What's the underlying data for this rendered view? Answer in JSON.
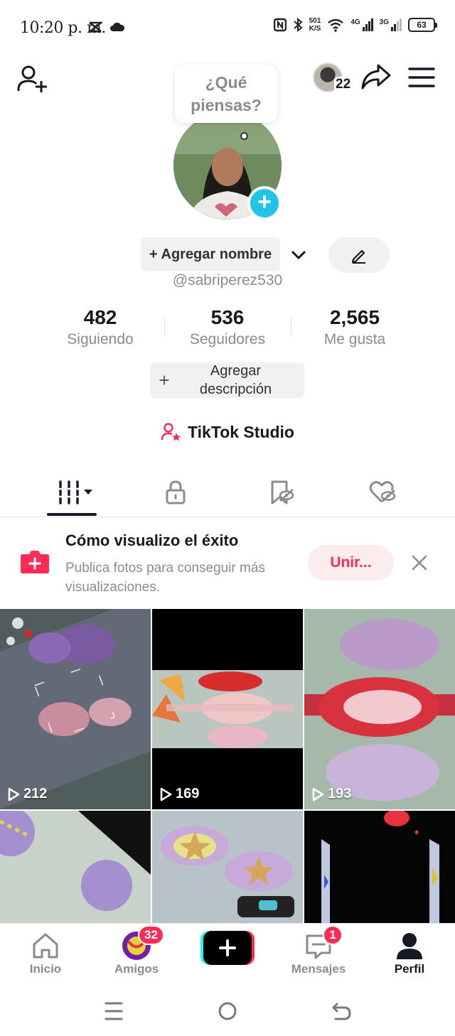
{
  "status_bar": {
    "time": "10:20 p. m.",
    "net_speed_value": "501",
    "net_speed_unit": "K/S",
    "signal_1_label": "4G",
    "signal_2_label": "3G",
    "battery": "63"
  },
  "header": {
    "friends_count": "22"
  },
  "profile": {
    "bubble_text": "¿Qué piensas?",
    "add_name_label": "+ Agregar nombre",
    "username": "@sabriperez530",
    "stats": [
      {
        "value": "482",
        "label": "Siguiendo"
      },
      {
        "value": "536",
        "label": "Seguidores"
      },
      {
        "value": "2,565",
        "label": "Me gusta"
      }
    ],
    "add_description_label": "Agregar descripción",
    "studio_label": "TikTok Studio"
  },
  "promo": {
    "title": "Cómo visualizo el éxito",
    "subtitle": "Publica fotos para conseguir más visualizaciones.",
    "join_label": "Unir..."
  },
  "videos": [
    {
      "views": "212"
    },
    {
      "views": "169"
    },
    {
      "views": "193"
    },
    {
      "views": ""
    },
    {
      "views": ""
    },
    {
      "views": ""
    }
  ],
  "bottom_nav": {
    "home": "Inicio",
    "friends": "Amigos",
    "friends_badge": "32",
    "messages": "Mensajes",
    "messages_badge": "1",
    "profile": "Perfil"
  },
  "colors": {
    "accent": "#fe2c55",
    "cyan": "#20c4e8",
    "text_primary": "#161823",
    "text_secondary": "#8a8b91"
  }
}
